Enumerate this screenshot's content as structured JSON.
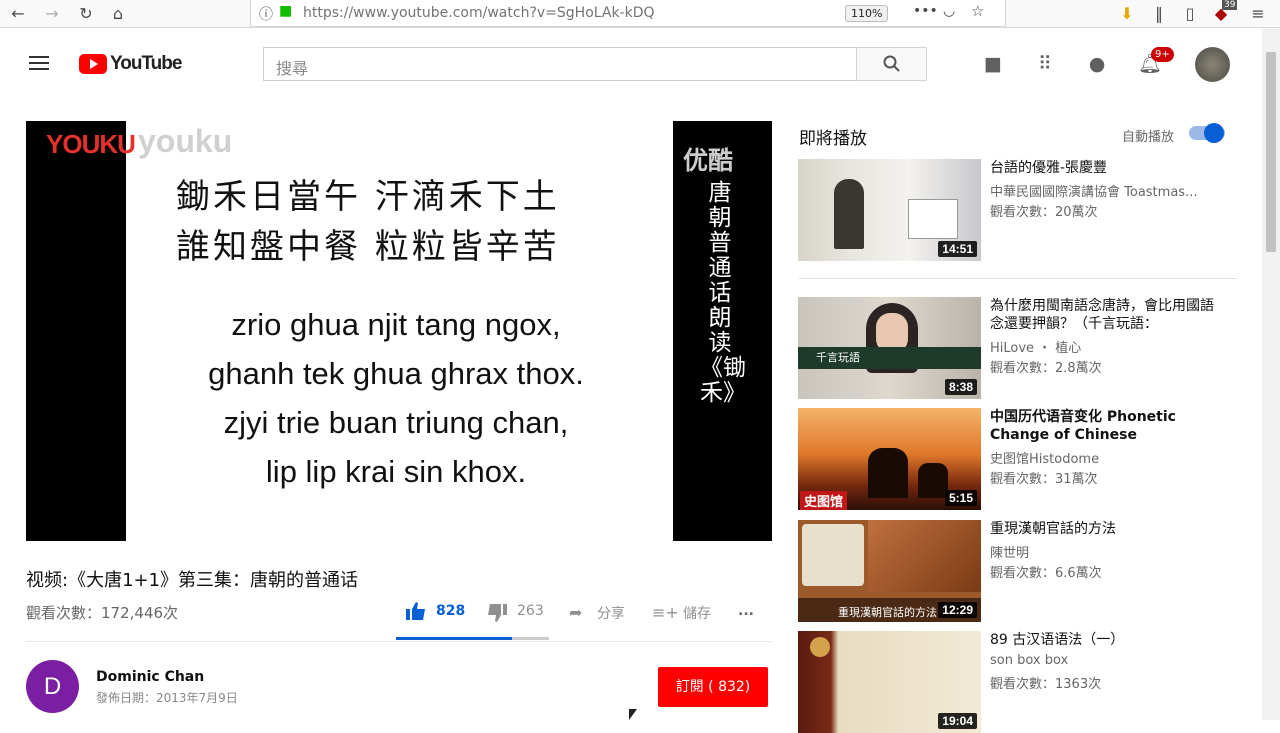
{
  "browser": {
    "url": "https://www.youtube.com/watch?v=SgHoLAk-kDQ",
    "zoom": "110%",
    "ext_badge": "39"
  },
  "header": {
    "logo_text": "YouTube",
    "search_placeholder": "搜尋",
    "notif_count": "9+"
  },
  "video": {
    "watermark": "YOUKU",
    "watermark2": "youku",
    "poem_line1": "鋤禾日當午  汗滴禾下土",
    "poem_line2": "誰知盤中餐  粒粒皆辛苦",
    "pinyin": [
      "zrio ghua njit tang ngox,",
      "ghanh tek ghua ghrax thox.",
      "zjyi trie buan triung chan,",
      "lip lip krai sin khox."
    ],
    "side_logo": "优酷",
    "side_text": "唐朝普通话朗读《锄禾》",
    "title": "视频:《大唐1+1》第三集：唐朝的普通话",
    "views": "觀看次數：172,446次",
    "likes": "828",
    "dislikes": "263",
    "like_ratio": 0.759,
    "share": "分享",
    "save": "儲存",
    "more": "..."
  },
  "channel": {
    "avatar_letter": "D",
    "name": "Dominic Chan",
    "date": "發佈日期：2013年7月9日",
    "subscribe": "訂閱 ( 832)",
    "avatar_color": "#7b1fa2"
  },
  "sidebar": {
    "up_next": "即將播放",
    "autoplay": "自動播放",
    "autoplay_on": true,
    "items": [
      {
        "title": "台語的優雅-張慶豐",
        "channel": "中華民國國際演講協會 Toastmas...",
        "views": "觀看次數：20萬次",
        "duration": "14:51"
      },
      {
        "title": "為什麼用閩南語念唐詩，會比用國語念還要押韻？（千言玩語：",
        "channel": "HiLove ・ 植心",
        "views": "觀看次數：2.8萬次",
        "duration": "8:38",
        "overlay": "千言玩語"
      },
      {
        "title": "中国历代语音变化 Phonetic Change of Chinese",
        "channel": "史图馆Histodome",
        "views": "觀看次數：31萬次",
        "duration": "5:15",
        "overlay": "史图馆"
      },
      {
        "title": "重現漢朝官話的方法",
        "channel": "陳世明",
        "views": "觀看次數：6.6萬次",
        "duration": "12:29",
        "overlay": "重現漢朝官話的方法"
      },
      {
        "title": "89 古汉语语法（一）",
        "channel": "son box box",
        "views": "觀看次數：1363次",
        "duration": "19:04"
      }
    ]
  }
}
